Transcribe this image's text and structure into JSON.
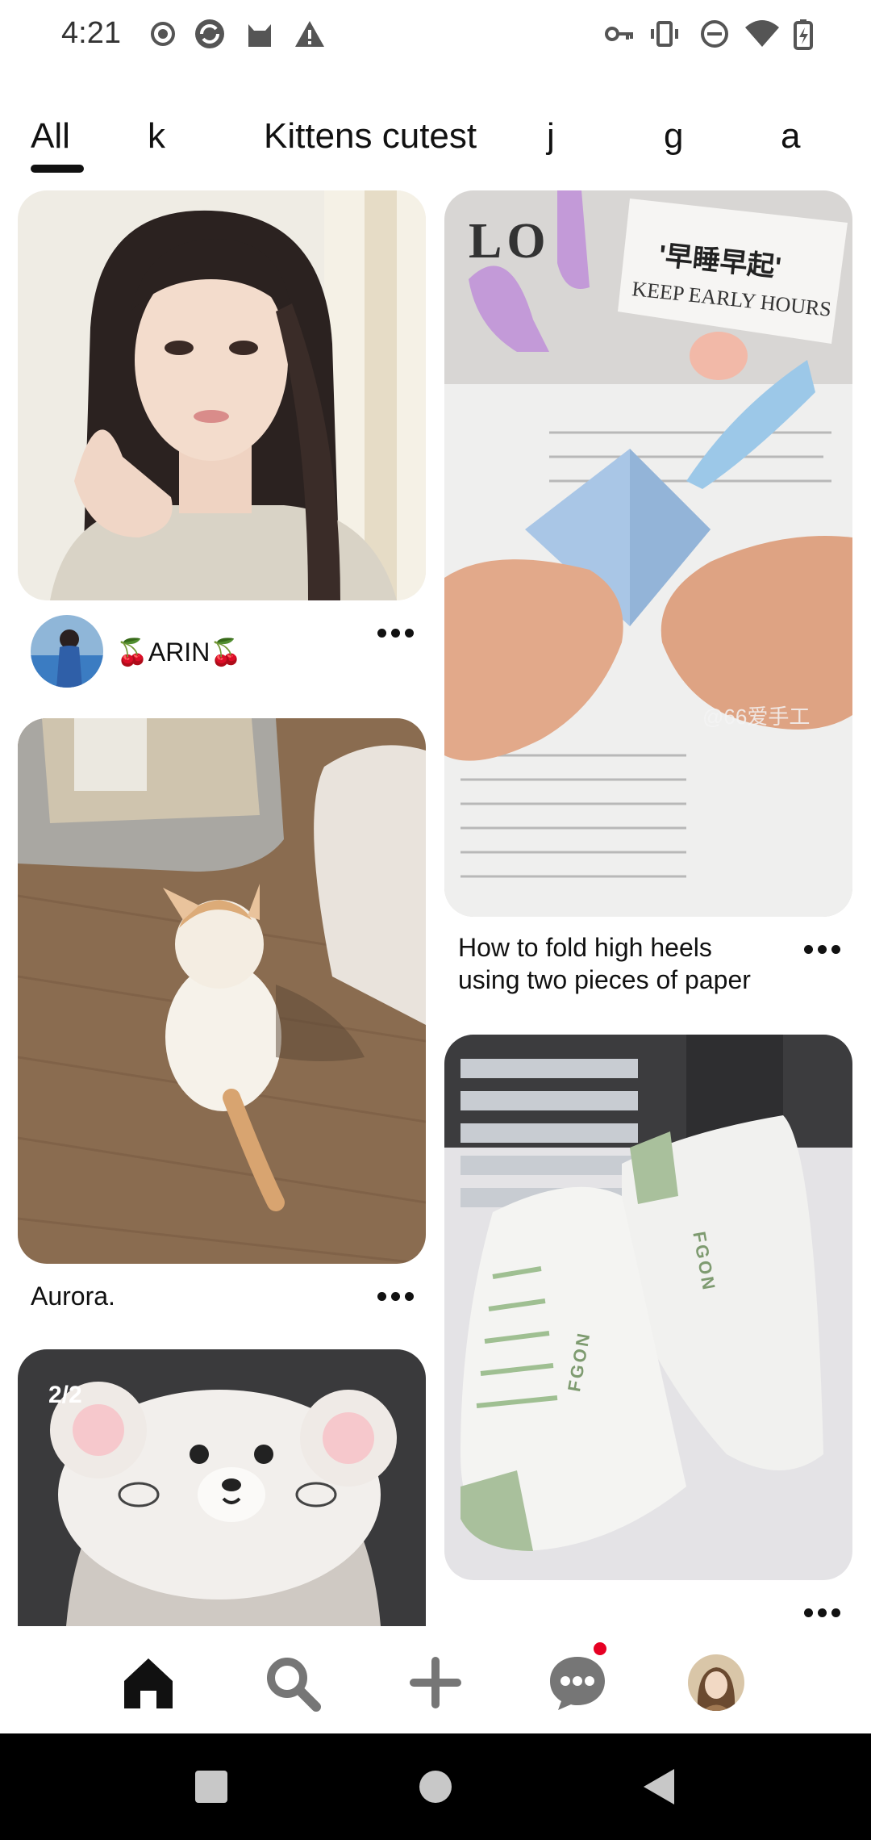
{
  "status_bar": {
    "time": "4:21",
    "left_icons": [
      "record-icon",
      "sync-app-icon",
      "cat-app-icon",
      "warning-icon"
    ],
    "right_icons": [
      "vpn-key-icon",
      "vibrate-icon",
      "do-not-disturb-icon",
      "wifi-icon",
      "battery-charging-icon"
    ]
  },
  "tabs": [
    {
      "label": "All",
      "selected": true
    },
    {
      "label": "k"
    },
    {
      "label": "Kittens cutest"
    },
    {
      "label": "j"
    },
    {
      "label": "g"
    },
    {
      "label": "a"
    }
  ],
  "feed": {
    "left_column": [
      {
        "type": "photo",
        "subject": "portrait of a young woman",
        "author": "🍒ARIN🍒"
      },
      {
        "type": "photo",
        "subject": "white kitten beside litter box",
        "title": "Aurora."
      },
      {
        "type": "photo",
        "subject": "cat wearing bear hat",
        "badge": "2/2"
      }
    ],
    "right_column": [
      {
        "type": "photo",
        "subject": "folding paper high heels",
        "title_line1": "How to fold high heels",
        "title_line2": "using two pieces of paper",
        "image_text": {
          "label1": "'早睡早起'",
          "label2": "KEEP EARLY HOURS",
          "watermark": "@66爱手工",
          "brand": "LO"
        }
      },
      {
        "type": "photo",
        "subject": "white and green high-top sneakers",
        "image_text": {
          "brand": "FGON"
        }
      }
    ]
  },
  "bottom_nav": [
    {
      "icon": "home-icon",
      "active": true
    },
    {
      "icon": "search-icon"
    },
    {
      "icon": "plus-icon"
    },
    {
      "icon": "chat-icon",
      "has_notification": true
    },
    {
      "icon": "profile-avatar"
    }
  ],
  "colors": {
    "accent": "#e60023",
    "text": "#111111",
    "nav_icon": "#767676"
  }
}
